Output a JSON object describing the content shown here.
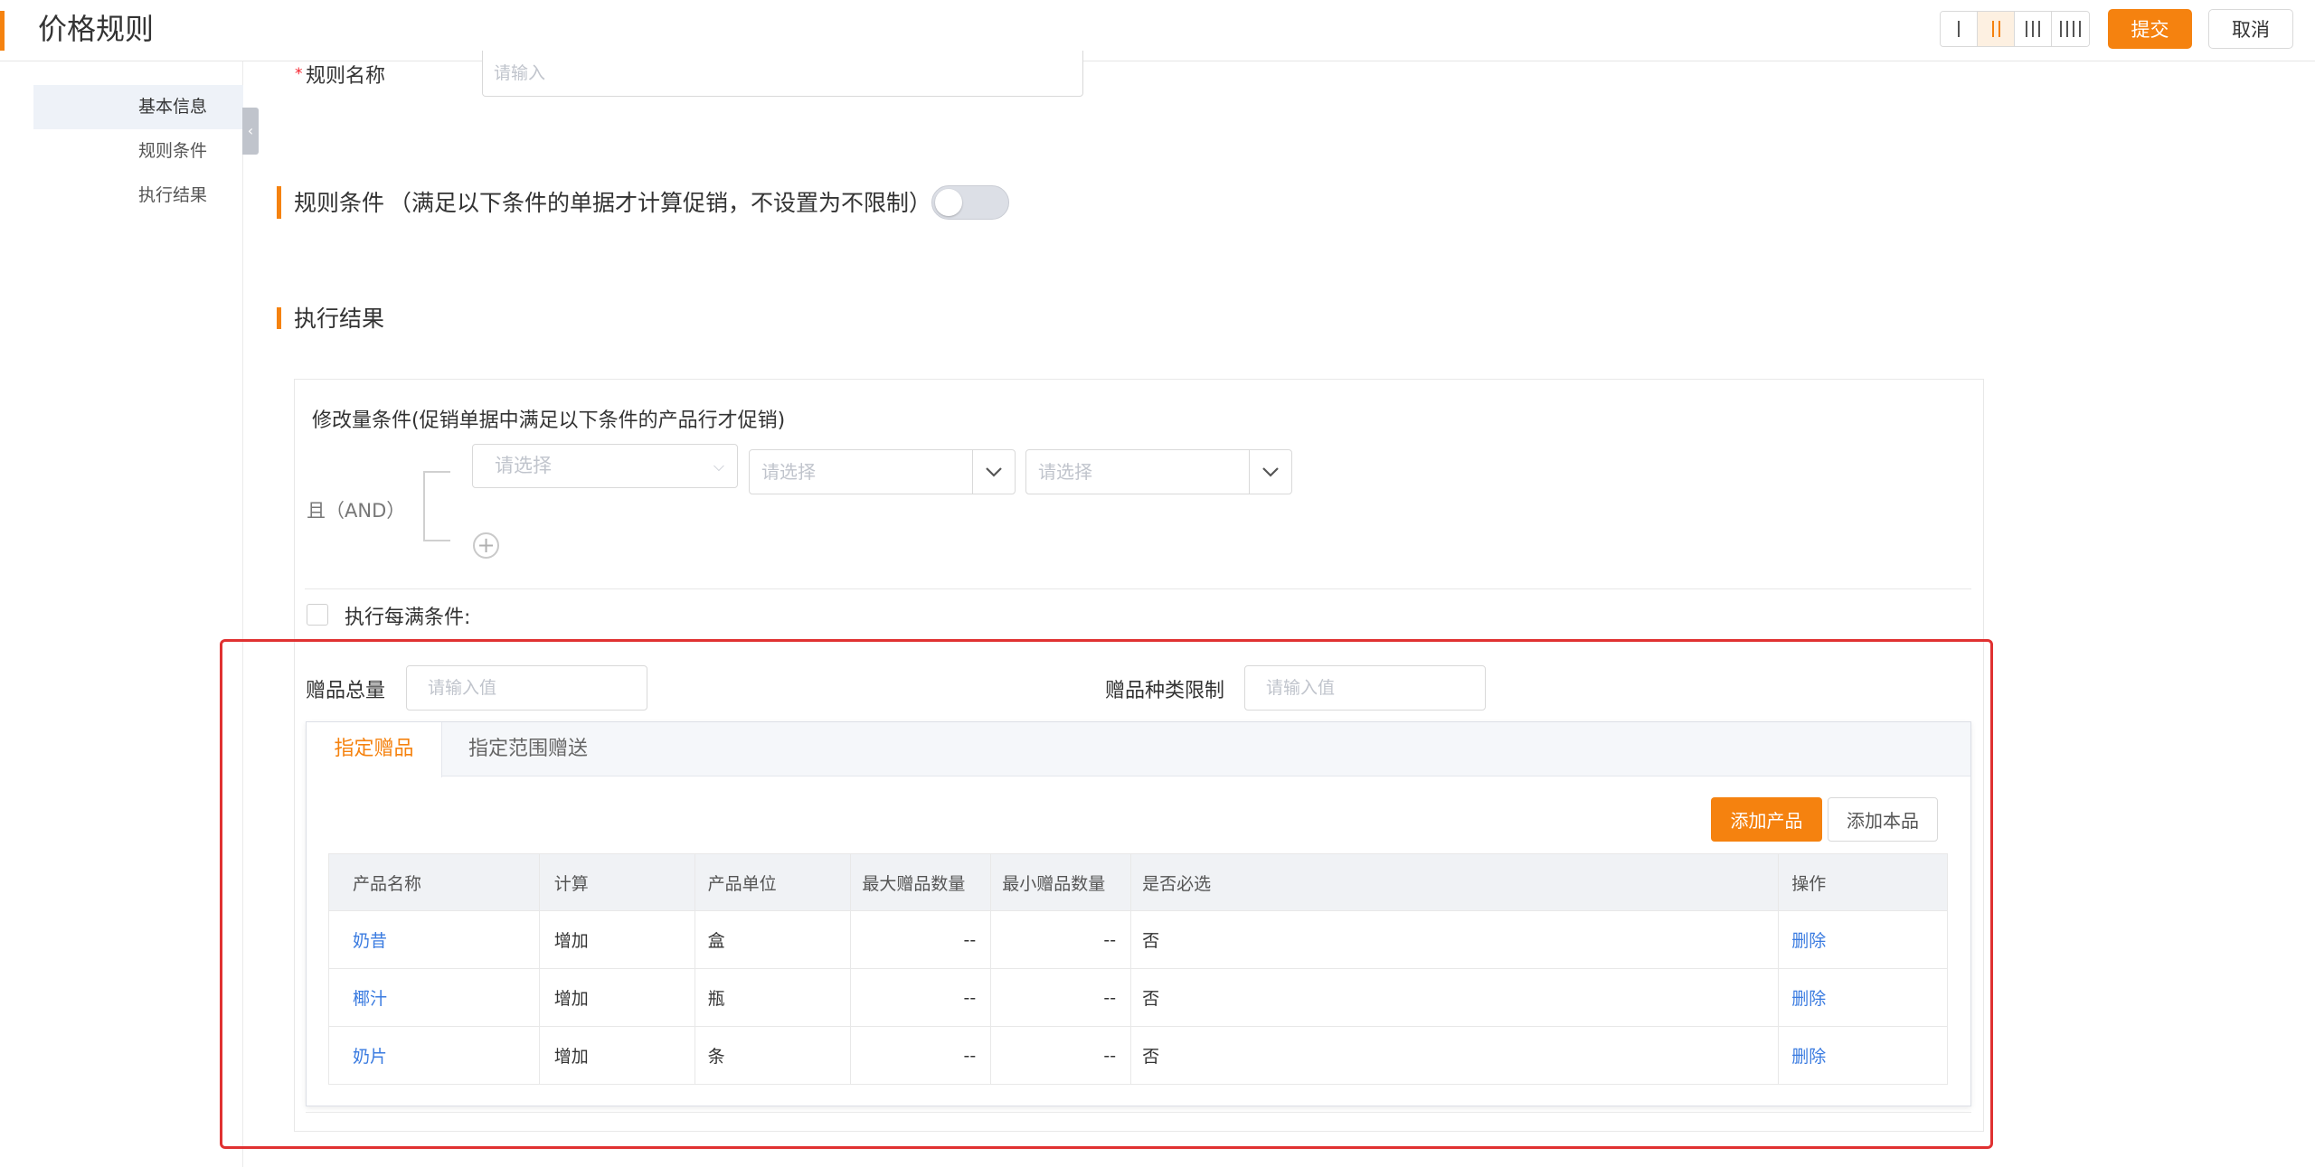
{
  "header": {
    "title": "价格规则",
    "layout_options": [
      "I",
      "II",
      "III",
      "IIII"
    ],
    "active_layout": "II",
    "submit_label": "提交",
    "cancel_label": "取消"
  },
  "sidebar": {
    "items": [
      {
        "label": "基本信息",
        "active": true
      },
      {
        "label": "规则条件",
        "active": false
      },
      {
        "label": "执行结果",
        "active": false
      }
    ],
    "collapse_icon": "chevron-left-icon"
  },
  "form": {
    "rule_name": {
      "label": "规则名称",
      "placeholder": "请输入",
      "required": true
    }
  },
  "rule_conditions": {
    "title": "规则条件",
    "note": "（满足以下条件的单据才计算促销，不设置为不限制）",
    "toggle_on": false
  },
  "execution_result": {
    "title": "执行结果",
    "quantity_condition_title": "修改量条件(促销单据中满足以下条件的产品行才促销)",
    "logic_label": "且（AND）",
    "select_placeholders": [
      "请选择",
      "请选择",
      "请选择"
    ],
    "each_full_label": "执行每满条件:",
    "gift_total": {
      "label": "赠品总量",
      "placeholder": "请输入值"
    },
    "gift_kind_limit": {
      "label": "赠品种类限制",
      "placeholder": "请输入值"
    },
    "tabs": [
      {
        "label": "指定赠品",
        "active": true
      },
      {
        "label": "指定范围赠送",
        "active": false
      }
    ],
    "add_product_label": "添加产品",
    "add_self_label": "添加本品",
    "table": {
      "columns": [
        "产品名称",
        "计算",
        "产品单位",
        "最大赠品数量",
        "最小赠品数量",
        "是否必选",
        "操作"
      ],
      "rows": [
        {
          "name": "奶昔",
          "calc": "增加",
          "unit": "盒",
          "max": "--",
          "min": "--",
          "required": "否",
          "action": "删除"
        },
        {
          "name": "椰汁",
          "calc": "增加",
          "unit": "瓶",
          "max": "--",
          "min": "--",
          "required": "否",
          "action": "删除"
        },
        {
          "name": "奶片",
          "calc": "增加",
          "unit": "条",
          "max": "--",
          "min": "--",
          "required": "否",
          "action": "删除"
        }
      ]
    }
  },
  "colors": {
    "accent": "#f5820f",
    "link": "#3a7be0",
    "highlight": "#e03131"
  }
}
